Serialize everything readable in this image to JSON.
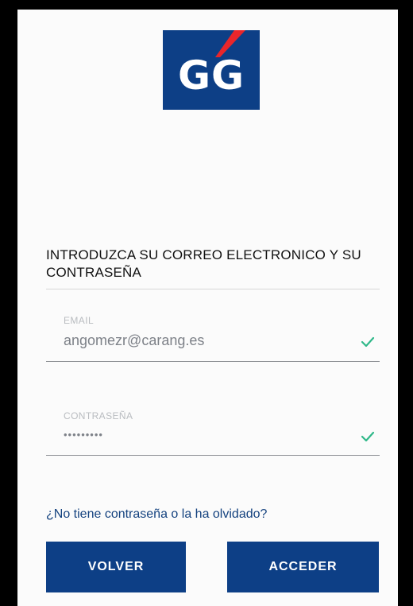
{
  "logo": {
    "text": "GG"
  },
  "heading": {
    "text": "INTRODUZCA SU CORREO ELECTRONICO Y SU CONTRASEÑA"
  },
  "email": {
    "label": "EMAIL",
    "value": "angomezr@carang.es",
    "status_icon": "check-icon"
  },
  "password": {
    "label": "CONTRASEÑA",
    "value": "•••••••••",
    "status_icon": "check-icon"
  },
  "forgot_link": {
    "text": "¿No tiene contraseña o la ha olvidado?"
  },
  "buttons": {
    "back_label": "VOLVER",
    "access_label": "ACCEDER"
  },
  "colors": {
    "brand": "#0d3f86",
    "accent": "#e8262b",
    "check": "#2fb889",
    "link": "#14427f"
  }
}
